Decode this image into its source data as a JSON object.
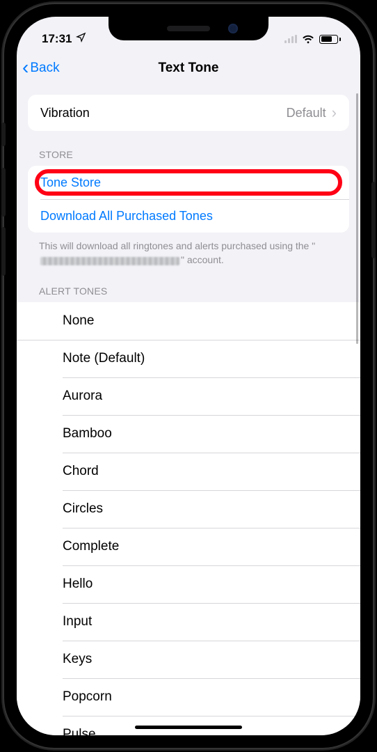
{
  "status": {
    "time": "17:31"
  },
  "nav": {
    "back_label": "Back",
    "title": "Text Tone"
  },
  "vibration": {
    "label": "Vibration",
    "value": "Default"
  },
  "store": {
    "header": "STORE",
    "tone_store_label": "Tone Store",
    "download_label": "Download All Purchased Tones",
    "footer_prefix": "This will download all ringtones and alerts purchased using the \"",
    "footer_suffix": "\" account."
  },
  "alert": {
    "header": "ALERT TONES",
    "items": [
      "None",
      "Note (Default)",
      "Aurora",
      "Bamboo",
      "Chord",
      "Circles",
      "Complete",
      "Hello",
      "Input",
      "Keys",
      "Popcorn",
      "Pulse"
    ]
  }
}
